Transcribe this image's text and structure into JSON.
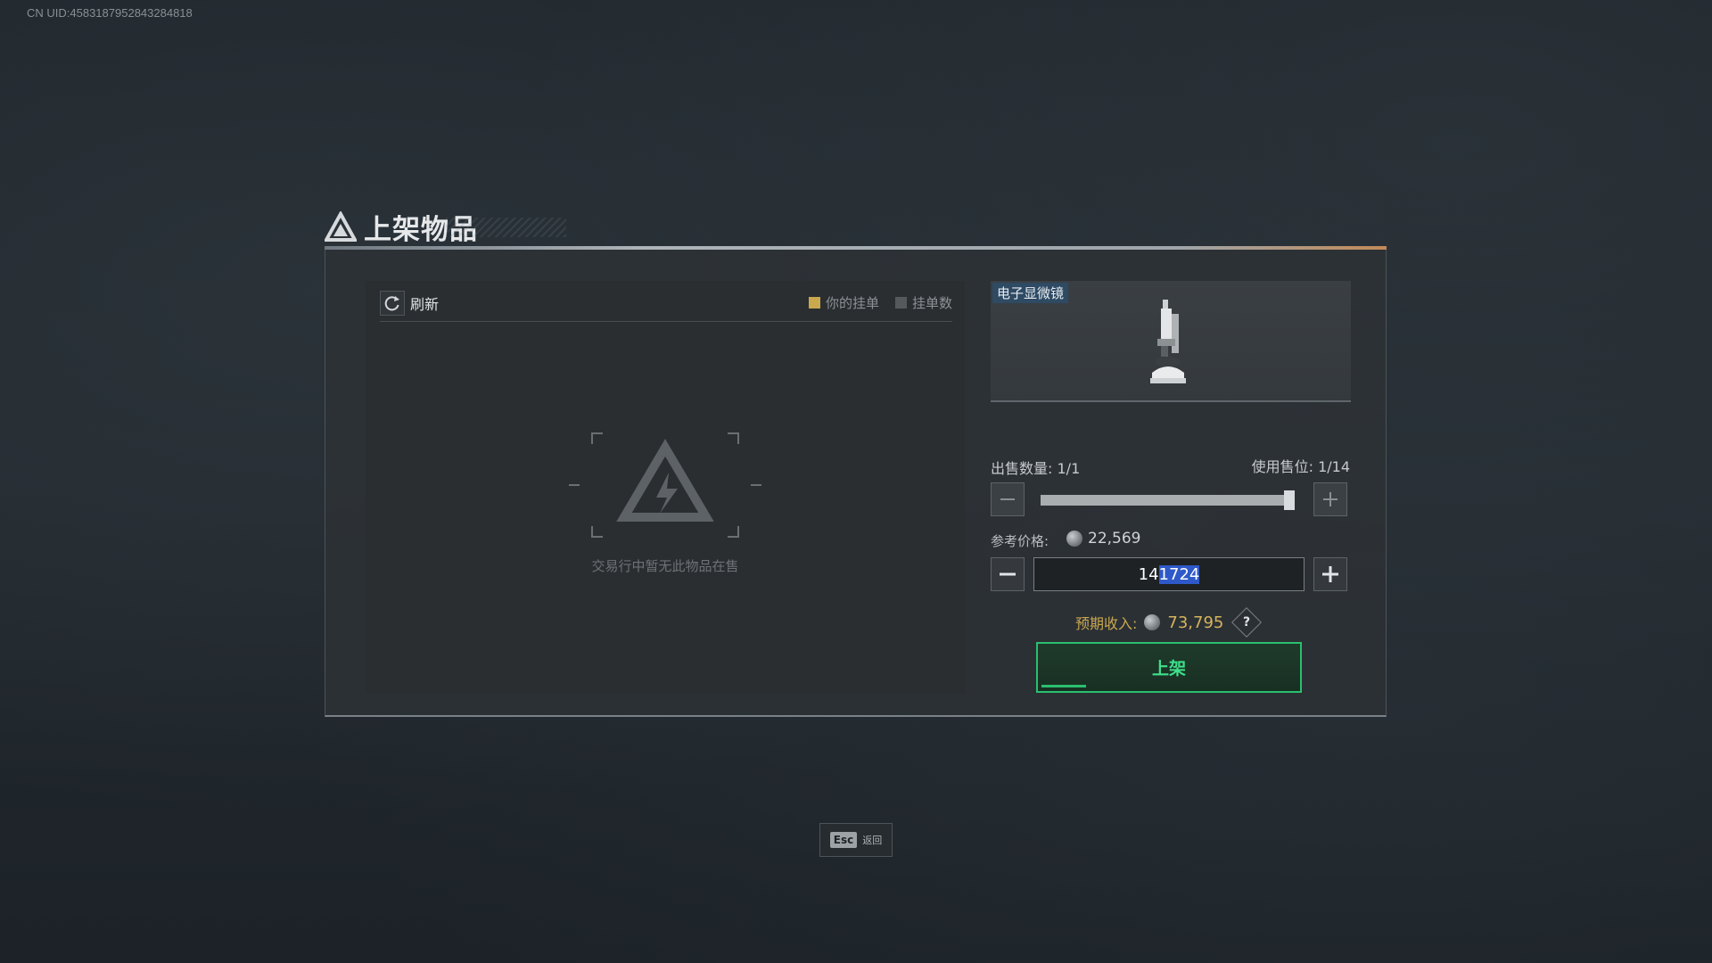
{
  "uid": "CN UID:4583187952843284818",
  "dialog": {
    "title": "上架物品"
  },
  "market": {
    "refresh_label": "刷新",
    "legend": [
      {
        "label": "你的挂单",
        "color": "#c9a84e"
      },
      {
        "label": "挂单数",
        "color": "#55595c"
      }
    ],
    "empty_text": "交易行中暂无此物品在售"
  },
  "item": {
    "name": "电子显微镜",
    "icon": "microscope-icon"
  },
  "sale": {
    "quantity_label": "出售数量:",
    "quantity_value": "1/1",
    "slots_label": "使用售位:",
    "slots_value": "1/14",
    "quantity_fraction": 1.0,
    "reference_label": "参考价格:",
    "reference_price": "22,569",
    "price_prefix": "14",
    "price_selected": "1724",
    "expected_label": "预期收入:",
    "expected_value": "73,795",
    "help_symbol": "?",
    "list_button": "上架"
  },
  "footer": {
    "esc_key": "Esc",
    "esc_label": "返回"
  },
  "colors": {
    "accent_green": "#2bbf6e",
    "accent_gold": "#c9a84e",
    "selection_blue": "#2f59c9"
  }
}
